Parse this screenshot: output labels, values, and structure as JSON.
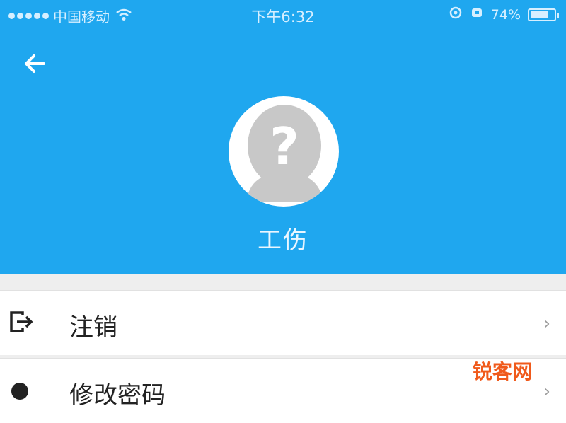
{
  "status_bar": {
    "carrier": "中国移动",
    "time": "下午6:32",
    "battery": "74%",
    "battery_level": 0.74
  },
  "profile": {
    "name": "工伤"
  },
  "menu": {
    "items": [
      {
        "label": "注销",
        "icon": "logout-icon"
      },
      {
        "label": "修改密码",
        "icon": "lock-icon"
      }
    ]
  },
  "watermark": "锐客网",
  "colors": {
    "header": "#1fa7ef",
    "background": "#eeeeee",
    "watermark": "#f05a1b"
  }
}
